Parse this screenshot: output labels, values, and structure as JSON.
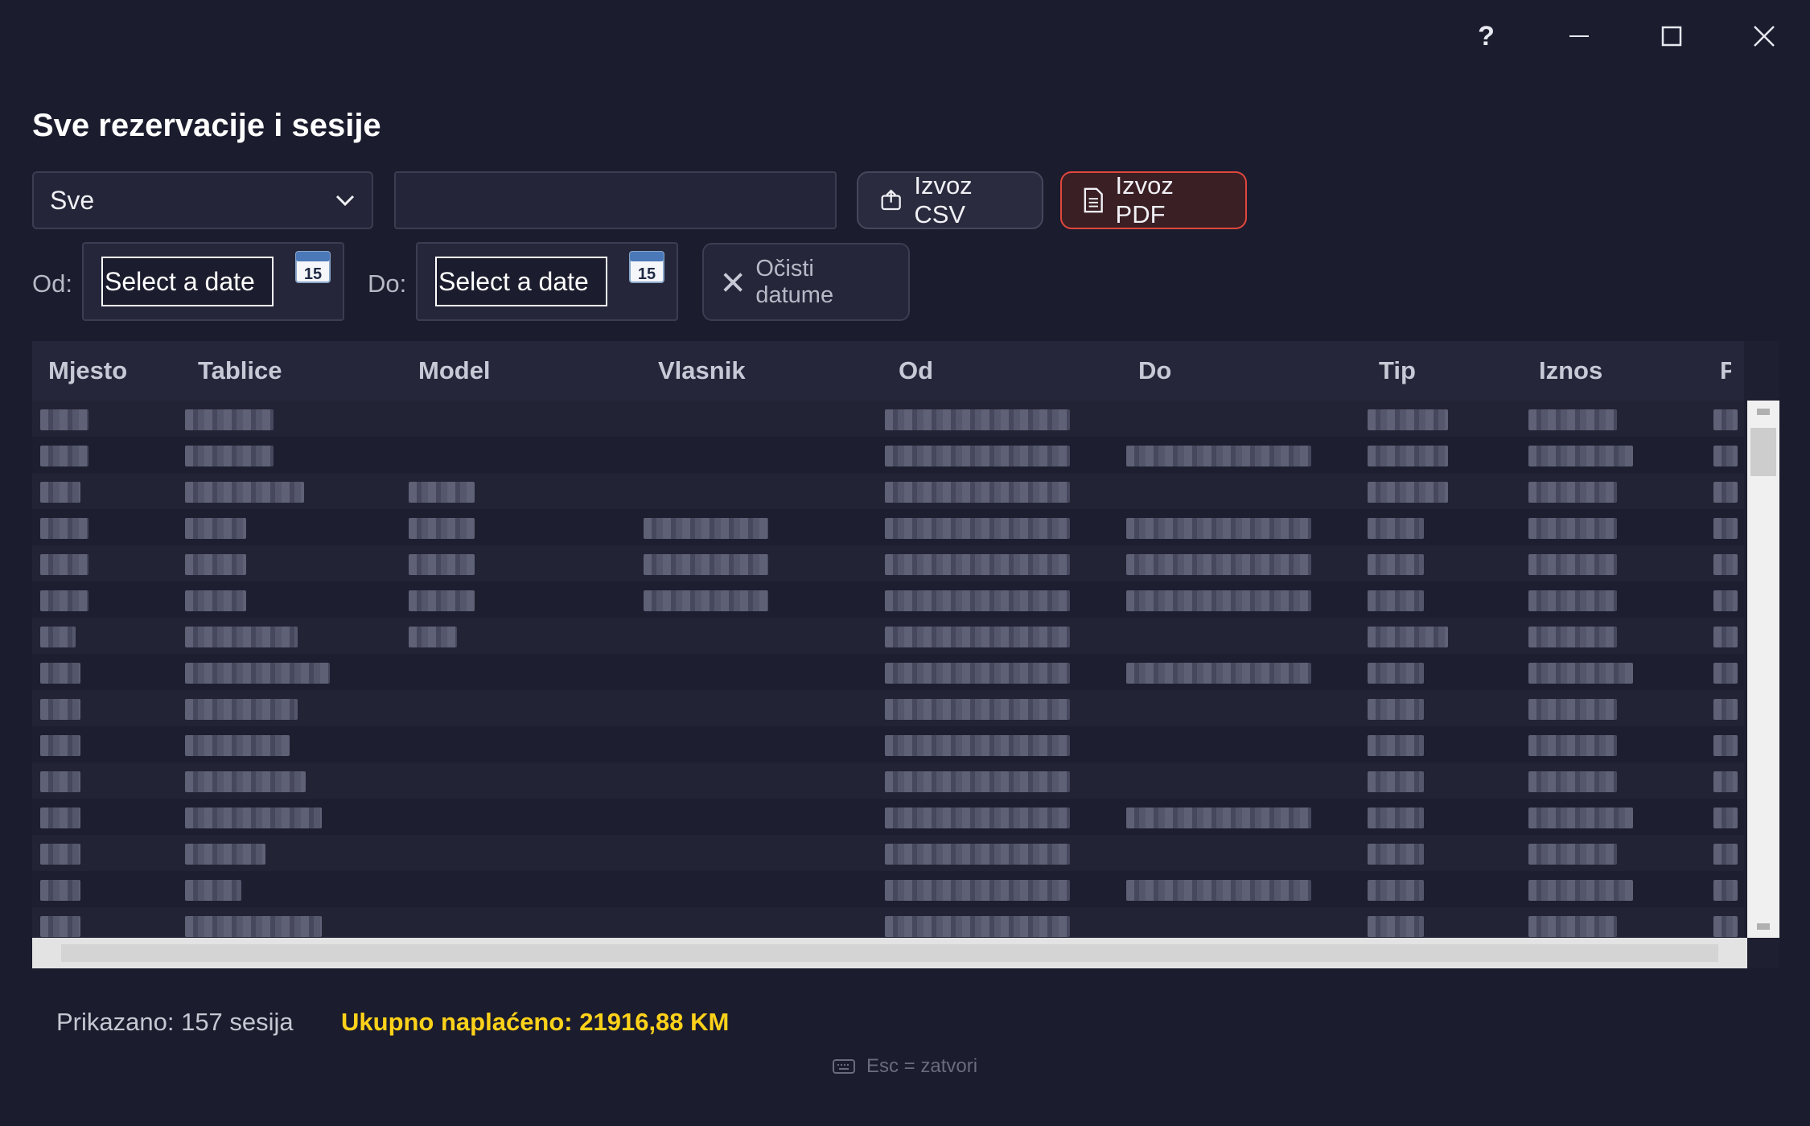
{
  "window": {
    "help_label": "?"
  },
  "page": {
    "title": "Sve rezervacije i sesije"
  },
  "filters": {
    "type_select_value": "Sve",
    "search_value": "",
    "export_csv_label": "Izvoz CSV",
    "export_pdf_label": "Izvoz PDF",
    "from_label": "Od:",
    "to_label": "Do:",
    "from_placeholder": "Select a date",
    "to_placeholder": "Select a date",
    "calendar_day": "15",
    "clear_dates_label": "Očisti datume"
  },
  "table": {
    "columns": [
      "Mjesto",
      "Tablice",
      "Model",
      "Vlasnik",
      "Od",
      "Do",
      "Tip",
      "Iznos",
      "P"
    ]
  },
  "footer": {
    "count_text": "Prikazano: 157 sesija",
    "total_text": "Ukupno naplaćeno: 21916,88 KM",
    "hint_text": "Esc = zatvori"
  },
  "colors": {
    "background": "#1b1c2d",
    "accent_pdf": "#e0473e",
    "total_highlight": "#ffd21a"
  }
}
